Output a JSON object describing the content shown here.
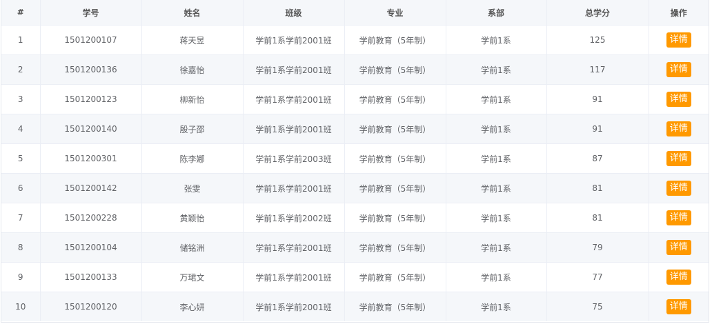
{
  "table": {
    "headers": {
      "idx": "#",
      "student_id": "学号",
      "name": "姓名",
      "class": "班级",
      "major": "专业",
      "dept": "系部",
      "credits": "总学分",
      "action": "操作"
    },
    "action_label": "详情",
    "accent_color": "#ff9900",
    "rows": [
      {
        "idx": "1",
        "student_id": "1501200107",
        "name": "蒋天昱",
        "class": "学前1系学前2001班",
        "major": "学前教育（5年制）",
        "dept": "学前1系",
        "credits": "125"
      },
      {
        "idx": "2",
        "student_id": "1501200136",
        "name": "徐嘉怡",
        "class": "学前1系学前2001班",
        "major": "学前教育（5年制）",
        "dept": "学前1系",
        "credits": "117"
      },
      {
        "idx": "3",
        "student_id": "1501200123",
        "name": "柳新怡",
        "class": "学前1系学前2001班",
        "major": "学前教育（5年制）",
        "dept": "学前1系",
        "credits": "91"
      },
      {
        "idx": "4",
        "student_id": "1501200140",
        "name": "殷子邵",
        "class": "学前1系学前2001班",
        "major": "学前教育（5年制）",
        "dept": "学前1系",
        "credits": "91"
      },
      {
        "idx": "5",
        "student_id": "1501200301",
        "name": "陈李娜",
        "class": "学前1系学前2003班",
        "major": "学前教育（5年制）",
        "dept": "学前1系",
        "credits": "87"
      },
      {
        "idx": "6",
        "student_id": "1501200142",
        "name": "张雯",
        "class": "学前1系学前2001班",
        "major": "学前教育（5年制）",
        "dept": "学前1系",
        "credits": "81"
      },
      {
        "idx": "7",
        "student_id": "1501200228",
        "name": "黄颖怡",
        "class": "学前1系学前2002班",
        "major": "学前教育（5年制）",
        "dept": "学前1系",
        "credits": "81"
      },
      {
        "idx": "8",
        "student_id": "1501200104",
        "name": "储铭洲",
        "class": "学前1系学前2001班",
        "major": "学前教育（5年制）",
        "dept": "学前1系",
        "credits": "79"
      },
      {
        "idx": "9",
        "student_id": "1501200133",
        "name": "万珺文",
        "class": "学前1系学前2001班",
        "major": "学前教育（5年制）",
        "dept": "学前1系",
        "credits": "77"
      },
      {
        "idx": "10",
        "student_id": "1501200120",
        "name": "李心妍",
        "class": "学前1系学前2001班",
        "major": "学前教育（5年制）",
        "dept": "学前1系",
        "credits": "75"
      }
    ]
  }
}
